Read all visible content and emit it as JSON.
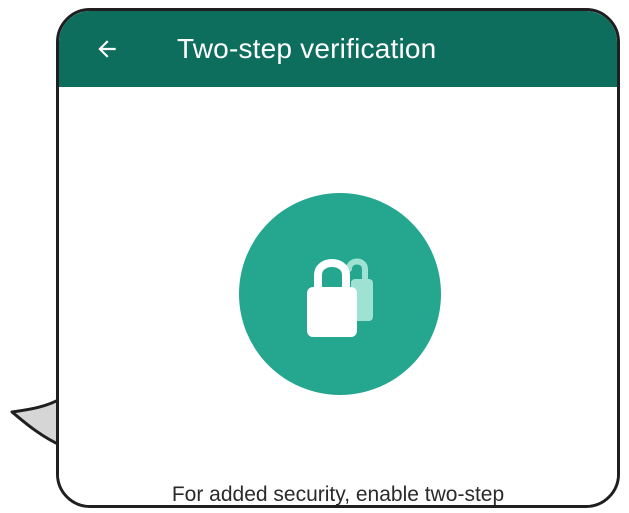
{
  "app_bar": {
    "title": "Two-step verification",
    "background_color": "#0e6e5d",
    "back_icon": "arrow-back-icon"
  },
  "hero": {
    "icon": "lock-icon",
    "circle_color": "#25a68f"
  },
  "description": {
    "text": "For added security, enable two-step"
  }
}
